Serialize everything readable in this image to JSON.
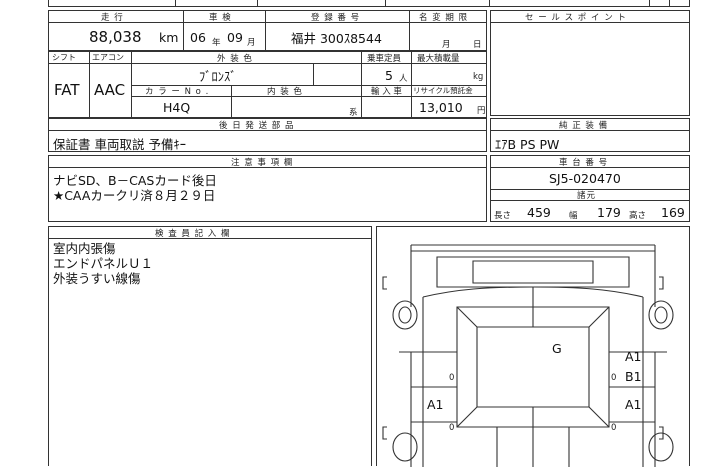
{
  "headers": {
    "mileage": "走 行",
    "inspection": "車 検",
    "registration": "登 録 番 号",
    "title_expiry": "名 変 期 限",
    "sales_point": "セ ー ル ス ポ イ ン ト",
    "shift": "シフト",
    "aircon": "エアコン",
    "exterior_color": "外 装 色",
    "capacity": "乗車定員",
    "max_load": "最大積載量",
    "color_no": "カ ラ ー N o .",
    "interior_color": "内 装 色",
    "import": "輸 入 車",
    "recycle": "リサイクル預託金",
    "parts": "後 日 発 送 部 品",
    "equipment": "純 正 装 備",
    "notes": "注 意 事 項 欄",
    "chassis": "車 台 番 号",
    "dimensions": "諸元",
    "inspector": "検 査 員 記 入 欄"
  },
  "vehicle": {
    "mileage": "88,038",
    "mileage_unit": "km",
    "inspection_year": "06",
    "inspection_year_unit": "年",
    "inspection_month": "09",
    "inspection_month_unit": "月",
    "plate": "福井 300ｽ8544",
    "title_month": "月",
    "title_day": "日",
    "shift": "FAT",
    "aircon": "AAC",
    "exterior_color": "ﾌﾞﾛﾝｽﾞ",
    "capacity": "5",
    "capacity_unit": "人",
    "load_unit": "kg",
    "color_no": "H4Q",
    "interior_unit": "系",
    "recycle_fee": "13,010",
    "recycle_unit": "円",
    "parts": "保証書 車両取説 予備ｷｰ",
    "equipment": "ｴｱB PS PW",
    "chassis": "SJ5-020470",
    "length_label": "長さ",
    "length": "459",
    "width_label": "幅",
    "width": "179",
    "height_label": "高さ",
    "height": "169"
  },
  "notes": [
    "ナビSD、B－CASカード後日",
    "★CAAカークリ済８月２９日"
  ],
  "inspector_notes": [
    "室内内張傷",
    "エンドパネルＵ１",
    "外装うすい線傷"
  ],
  "diagram_marks": {
    "mark_g": "G",
    "mark_a1_right_upper": "A1",
    "mark_b1": "B1",
    "mark_a1_left": "A1",
    "mark_a1_right_lower": "A1",
    "zero_1": "0",
    "zero_2": "0",
    "zero_3": "0",
    "zero_4": "0"
  }
}
